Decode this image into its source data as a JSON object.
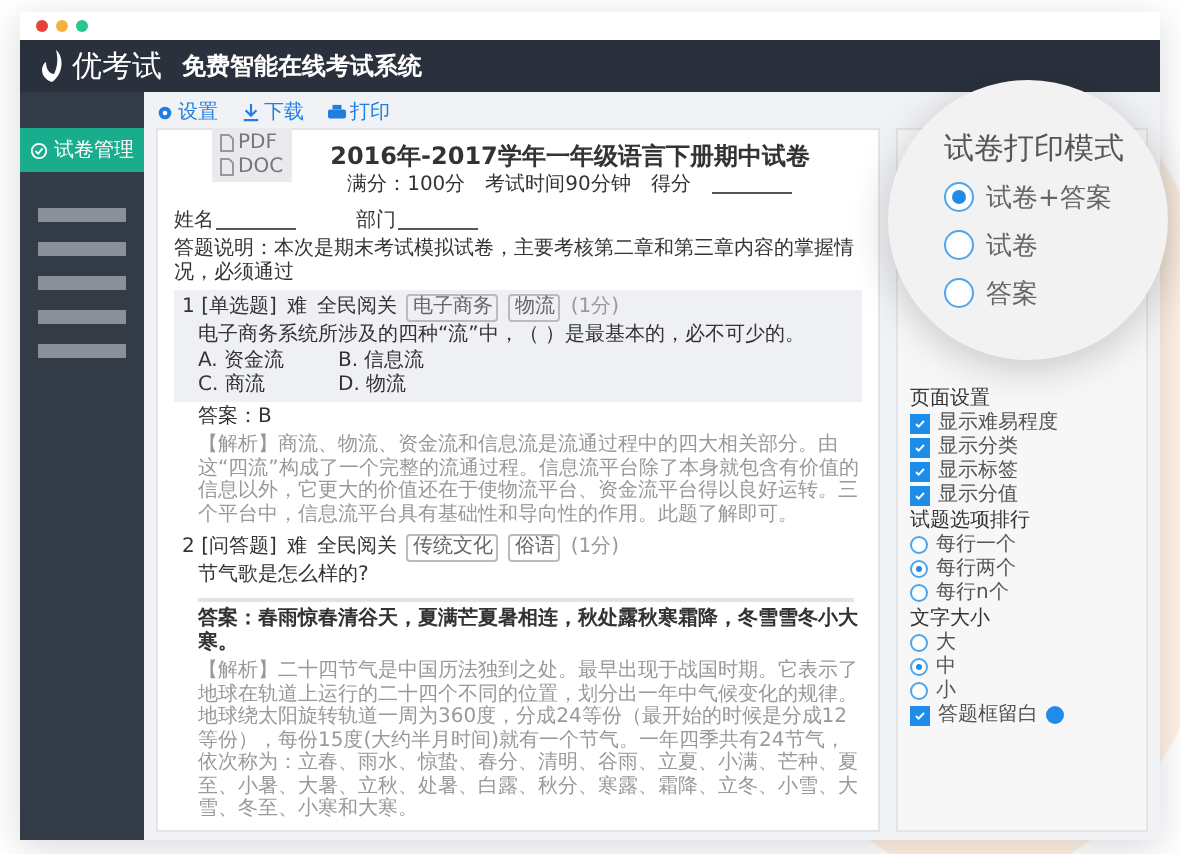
{
  "app": {
    "logo_text": "优考试",
    "tagline": "免费智能在线考试系统"
  },
  "sidebar": {
    "items": [
      {
        "label": "试卷管理",
        "selected": true
      }
    ]
  },
  "toolbar": [
    {
      "kind": "settings",
      "label": "设置"
    },
    {
      "kind": "download",
      "label": "下载"
    },
    {
      "kind": "print",
      "label": "打印"
    }
  ],
  "download_menu": [
    "PDF",
    "DOC"
  ],
  "paper": {
    "title": "2016年-2017学年一年级语言下册期中试卷",
    "meta": [
      "满分：100分",
      "考试时间90分钟",
      "得分"
    ],
    "fields": [
      "姓名",
      "部门"
    ],
    "instructions": "答题说明：本次是期末考试模拟试卷，主要考核第二章和第三章内容的掌握情况，必须通过",
    "questions": [
      {
        "number": "1",
        "type": "[单选题]",
        "difficulty": "难",
        "scope": "全民阅关",
        "tags": [
          "电子商务",
          "物流"
        ],
        "score": "(1分)",
        "highlighted": true,
        "stem": "电子商务系统所涉及的四种“流”中，（  ）是最基本的，必不可少的。",
        "options": [
          "A. 资金流",
          "B. 信息流",
          "C. 商流",
          "D. 物流"
        ],
        "answer": "答案：B",
        "analysis": "【解析】商流、物流、资金流和信息流是流通过程中的四大相关部分。由这“四流”构成了一个完整的流通过程。信息流平台除了本身就包含有价值的信息以外，它更大的价值还在于使物流平台、资金流平台得以良好运转。三个平台中，信息流平台具有基础性和导向性的作用。此题了解即可。"
      },
      {
        "number": "2",
        "type": "[问答题]",
        "difficulty": "难",
        "scope": "全民阅关",
        "tags": [
          "传统文化",
          "俗语"
        ],
        "score": "(1分)",
        "highlighted": false,
        "stem": "节气歌是怎么样的?",
        "answer": "答案：春雨惊春清谷天，夏满芒夏暑相连，秋处露秋寒霜降，冬雪雪冬小大寒。",
        "analysis": "【解析】二十四节气是中国历法独到之处。最早出现于战国时期。它表示了地球在轨道上运行的二十四个不同的位置，划分出一年中气候变化的规律。地球绕太阳旋转轨道一周为360度，分成24等份（最开始的时候是分成12等份），每份15度(大约半月时间)就有一个节气。一年四季共有24节气，依次称为：立春、雨水、惊蛰、春分、清明、谷雨、立夏、小满、芒种、夏至、小暑、大暑、立秋、处暑、白露、秋分、寒露、霜降、立冬、小雪、大雪、冬至、小寒和大寒。"
      }
    ]
  },
  "print_mode": {
    "title": "试卷打印模式",
    "options": [
      {
        "label": "试卷+答案",
        "selected": true
      },
      {
        "label": "试卷",
        "selected": false
      },
      {
        "label": "答案",
        "selected": false
      }
    ]
  },
  "page_settings": {
    "title": "页面设置",
    "checkboxes": [
      {
        "label": "显示难易程度",
        "checked": true
      },
      {
        "label": "显示分类",
        "checked": true
      },
      {
        "label": "显示标签",
        "checked": true
      },
      {
        "label": "显示分值",
        "checked": true
      }
    ],
    "groups": [
      {
        "title": "试题选项排行",
        "options": [
          {
            "label": "每行一个",
            "selected": false
          },
          {
            "label": "每行两个",
            "selected": true
          },
          {
            "label": "每行n个",
            "selected": false
          }
        ]
      },
      {
        "title": "文字大小",
        "options": [
          {
            "label": "大",
            "selected": false
          },
          {
            "label": "中",
            "selected": true
          },
          {
            "label": "小",
            "selected": false
          }
        ]
      }
    ],
    "blank": {
      "label": "答题框留白",
      "checked": true
    }
  }
}
